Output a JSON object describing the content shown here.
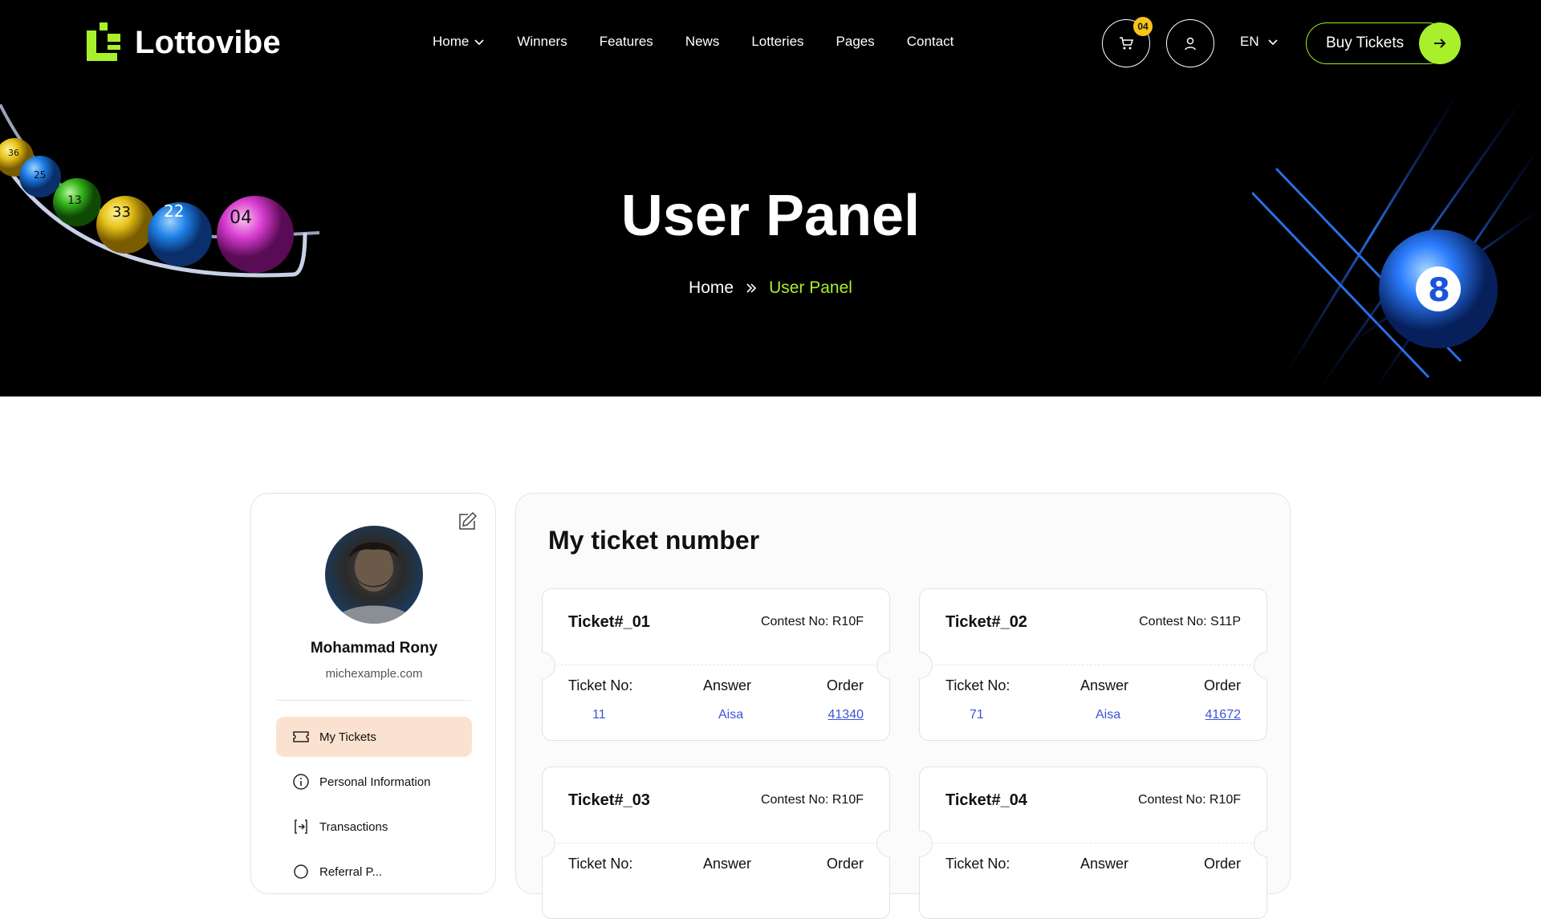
{
  "brand": {
    "name": "Lottovibe",
    "accent": "#a8f02c",
    "badge_color": "#f5c518"
  },
  "nav": {
    "items": [
      {
        "label": "Home",
        "has_dropdown": true
      },
      {
        "label": "Winners"
      },
      {
        "label": "Features"
      },
      {
        "label": "News"
      },
      {
        "label": "Lotteries"
      },
      {
        "label": "Pages"
      },
      {
        "label": "Contact"
      }
    ],
    "cart_count": "04",
    "language": "EN",
    "cta_label": "Buy Tickets"
  },
  "hero": {
    "title": "User Panel",
    "breadcrumb": {
      "home": "Home",
      "current": "User Panel"
    }
  },
  "profile": {
    "name": "Mohammad Rony",
    "email": "michexample.com",
    "menu": [
      {
        "label": "My Tickets",
        "icon": "ticket-icon",
        "active": true
      },
      {
        "label": "Personal Information",
        "icon": "info-icon"
      },
      {
        "label": "Transactions",
        "icon": "transactions-icon"
      },
      {
        "label": "Referral P...",
        "icon": "referral-icon"
      }
    ]
  },
  "tickets_panel": {
    "title": "My ticket number",
    "headers": {
      "ticket_no": "Ticket No:",
      "answer": "Answer",
      "order": "Order"
    },
    "tickets": [
      {
        "name": "Ticket#_01",
        "contest": "Contest No: R10F",
        "ticket_no": "11",
        "answer": "Aisa",
        "order": "41340"
      },
      {
        "name": "Ticket#_02",
        "contest": "Contest No: S11P",
        "ticket_no": "71",
        "answer": "Aisa",
        "order": "41672"
      },
      {
        "name": "Ticket#_03",
        "contest": "Contest No: R10F",
        "ticket_no": "",
        "answer": "",
        "order": ""
      },
      {
        "name": "Ticket#_04",
        "contest": "Contest No: R10F",
        "ticket_no": "",
        "answer": "",
        "order": ""
      }
    ]
  },
  "decor": {
    "lottery_balls": [
      "36",
      "25",
      "13",
      "33",
      "22",
      "04"
    ],
    "featured_ball": "8"
  }
}
